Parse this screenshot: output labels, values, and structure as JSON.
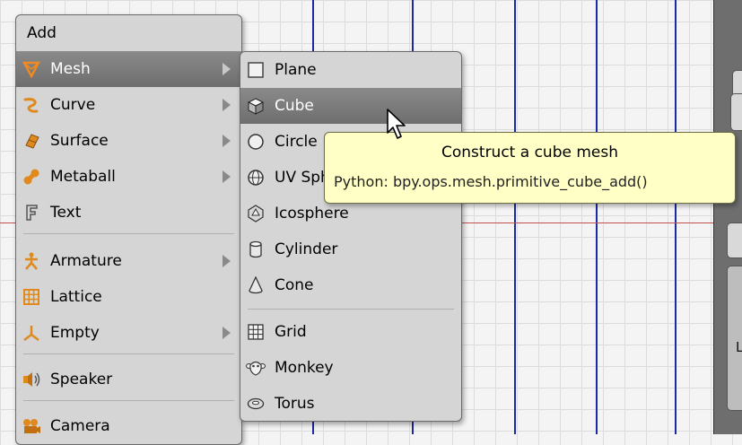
{
  "add_menu": {
    "title": "Add",
    "items": [
      {
        "label": "Mesh",
        "icon": "mesh-icon",
        "submenu": true,
        "active": true
      },
      {
        "label": "Curve",
        "icon": "curve-icon",
        "submenu": true
      },
      {
        "label": "Surface",
        "icon": "surface-icon",
        "submenu": true
      },
      {
        "label": "Metaball",
        "icon": "metaball-icon",
        "submenu": true
      },
      {
        "label": "Text",
        "icon": "text-icon",
        "submenu": false
      },
      {
        "label": "Armature",
        "icon": "armature-icon",
        "submenu": true
      },
      {
        "label": "Lattice",
        "icon": "lattice-icon",
        "submenu": false
      },
      {
        "label": "Empty",
        "icon": "empty-icon",
        "submenu": true
      },
      {
        "label": "Speaker",
        "icon": "speaker-icon",
        "submenu": false
      },
      {
        "label": "Camera",
        "icon": "camera-icon",
        "submenu": false
      }
    ]
  },
  "mesh_menu": {
    "items": [
      {
        "label": "Plane",
        "icon": "plane-icon"
      },
      {
        "label": "Cube",
        "icon": "cube-icon",
        "active": true
      },
      {
        "label": "Circle",
        "icon": "circle-icon"
      },
      {
        "label": "UV Sphere",
        "icon": "uv-sphere-icon"
      },
      {
        "label": "Icosphere",
        "icon": "icosphere-icon"
      },
      {
        "label": "Cylinder",
        "icon": "cylinder-icon"
      },
      {
        "label": "Cone",
        "icon": "cone-icon"
      },
      {
        "label": "Grid",
        "icon": "grid-icon"
      },
      {
        "label": "Monkey",
        "icon": "monkey-icon"
      },
      {
        "label": "Torus",
        "icon": "torus-icon"
      }
    ]
  },
  "tooltip": {
    "title": "Construct a cube mesh",
    "python": "Python: bpy.ops.mesh.primitive_cube_add()"
  },
  "side_panel": {
    "label": "L"
  },
  "colors": {
    "menu_bg": "#d5d5d5",
    "highlight": "#7a7a7a",
    "icon_orange": "#e08a1e",
    "tooltip_bg": "#ffffc6",
    "grid_axis_blue": "#1a2aa0",
    "grid_axis_red": "#c05050"
  }
}
